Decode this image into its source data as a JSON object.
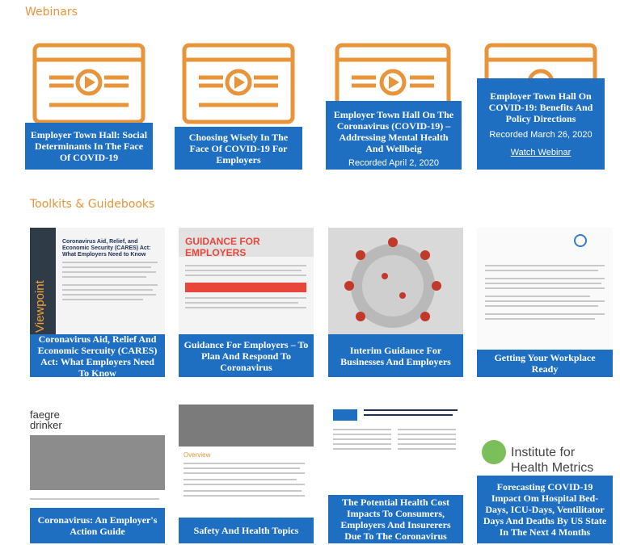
{
  "sections": {
    "webinars": "Webinars",
    "toolkits": "Toolkits & Guidebooks"
  },
  "webinars": [
    {
      "title": "Employer Town Hall: Social Determinants In The Face Of COVID-19"
    },
    {
      "title": "Choosing Wisely In The Face Of COVID-19 For Employers"
    },
    {
      "title": "Employer Town Hall On The Coronavirus (COVID-19) – Addressing Mental Health And Wellbeig",
      "recorded": "Recorded April 2, 2020"
    },
    {
      "title": "Employer Town Hall On COVID-19: Benefits And Policy Directions",
      "recorded": "Recorded March 26, 2020",
      "link": "Watch Webinar"
    }
  ],
  "toolkits": [
    {
      "title": "Coronavirus Aid, Relief And Economic Sercuity (CARES) Act: What Employers Need To Know",
      "thumb_heading": "Coronavirus Aid, Relief, and Economic Security (CARES) Act: What Employers Need to Know",
      "thumb_side": "Viewpoint"
    },
    {
      "title": "Guidance For Employers – To Plan And Respond To Coronavirus",
      "thumb_heading": "GUIDANCE FOR EMPLOYERS"
    },
    {
      "title": "Interim Guidance For Businesses And Employers"
    },
    {
      "title": "Getting Your Workplace Ready"
    },
    {
      "title": "Coronavirus: An Employer's Action Guide",
      "thumb_logo": "faegre drinker"
    },
    {
      "title": "Safety And Health Topics",
      "thumb_heading": "Overview"
    },
    {
      "title": "The Potential Health Cost Impacts To Consumers, Employers And Insurerers Due To The Coronavirus"
    },
    {
      "title": "Forecasting COVID-19 Impact Om Hospital Bed-Days, ICU-Days, Ventilitator Days And Deaths By US State In The Next 4 Months",
      "thumb_logo": "Institute for Health Metrics"
    }
  ],
  "colors": {
    "accent": "#e8943a",
    "caption": "#1e6fc2"
  }
}
